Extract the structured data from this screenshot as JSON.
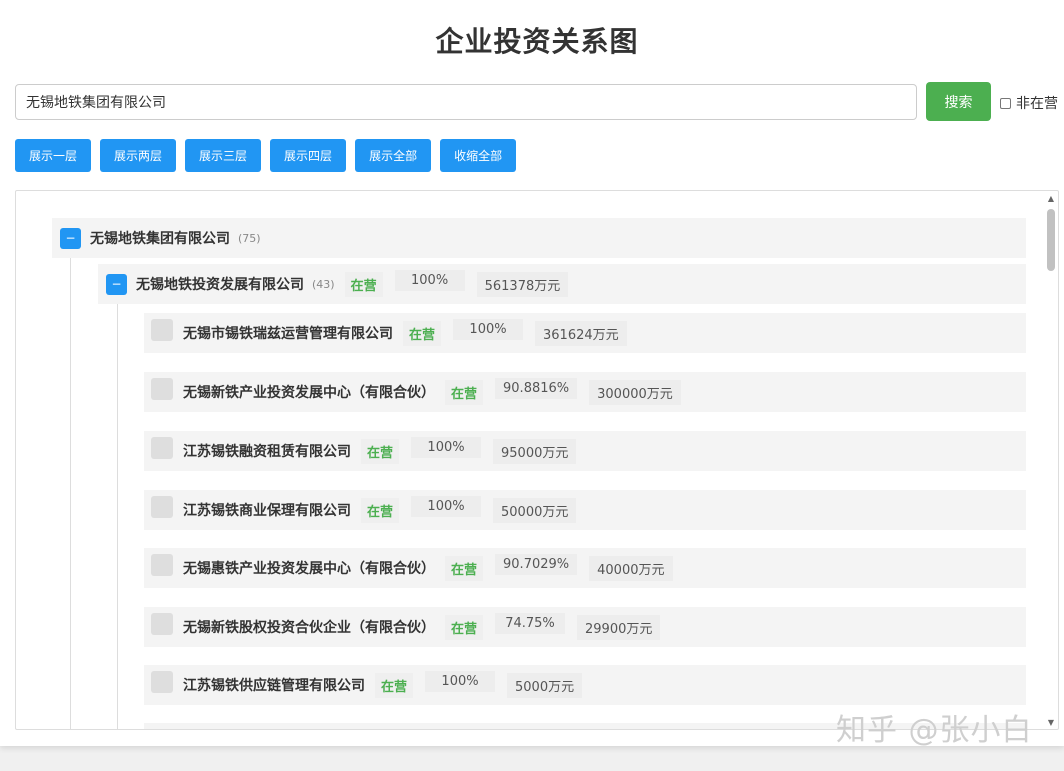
{
  "page": {
    "title": "企业投资关系图"
  },
  "search": {
    "value": "无锡地铁集团有限公司",
    "button_label": "搜索",
    "inactive_label": "非在营"
  },
  "level_buttons": [
    "展示一层",
    "展示两层",
    "展示三层",
    "展示四层",
    "展示全部",
    "收缩全部"
  ],
  "tree": {
    "root": {
      "name": "无锡地铁集团有限公司",
      "count": "(75)",
      "toggle": "−"
    },
    "child": {
      "name": "无锡地铁投资发展有限公司",
      "count": "(43)",
      "toggle": "−",
      "status": "在营",
      "ratio": "100%",
      "capital": "561378万元"
    },
    "grandchildren": [
      {
        "name": "无锡市锡铁瑞兹运营管理有限公司",
        "status": "在营",
        "ratio": "100%",
        "capital": "361624万元"
      },
      {
        "name": "无锡新铁产业投资发展中心（有限合伙）",
        "status": "在营",
        "ratio": "90.8816%",
        "capital": "300000万元"
      },
      {
        "name": "江苏锡铁融资租赁有限公司",
        "status": "在营",
        "ratio": "100%",
        "capital": "95000万元"
      },
      {
        "name": "江苏锡铁商业保理有限公司",
        "status": "在营",
        "ratio": "100%",
        "capital": "50000万元"
      },
      {
        "name": "无锡惠铁产业投资发展中心（有限合伙）",
        "status": "在营",
        "ratio": "90.7029%",
        "capital": "40000万元"
      },
      {
        "name": "无锡新铁股权投资合伙企业（有限合伙）",
        "status": "在营",
        "ratio": "74.75%",
        "capital": "29900万元"
      },
      {
        "name": "江苏锡铁供应链管理有限公司",
        "status": "在营",
        "ratio": "100%",
        "capital": "5000万元"
      }
    ]
  },
  "watermark": "知乎 @张小白",
  "colors": {
    "primary": "#2196f3",
    "success": "#4caf50"
  }
}
